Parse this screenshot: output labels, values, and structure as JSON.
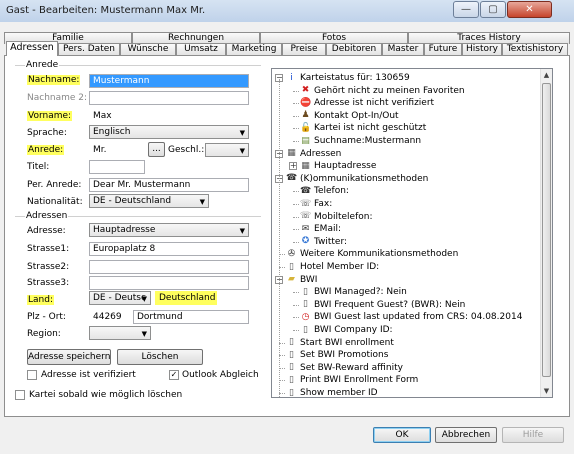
{
  "window": {
    "title": "Gast - Bearbeiten: Mustermann Max Mr."
  },
  "titlebar_buttons": {
    "minimize": "—",
    "maximize": "▢",
    "close": "✕"
  },
  "tabs_top": [
    "Familie",
    "Rechnungen",
    "Fotos",
    "Traces History"
  ],
  "tabs_bottom": [
    "Adressen",
    "Pers. Daten",
    "Wünsche",
    "Umsatz",
    "Marketing",
    "Preise",
    "Debitoren",
    "Master",
    "Future",
    "History",
    "Textishistory"
  ],
  "active_tab": "Adressen",
  "anrede_group": {
    "title": "Anrede",
    "nachname_label": "Nachname:",
    "nachname_value": "Mustermann",
    "nachname2_label": "Nachname 2:",
    "nachname2_value": "",
    "vorname_label": "Vorname:",
    "vorname_value": "Max",
    "sprache_label": "Sprache:",
    "sprache_value": "Englisch",
    "anrede_label": "Anrede:",
    "anrede_value": "Mr.",
    "anrede_button": "...",
    "geschl_label": "Geschl.:",
    "geschl_value": "",
    "titel_label": "Titel:",
    "titel_value": "",
    "per_anrede_label": "Per. Anrede:",
    "per_anrede_value": "Dear Mr. Mustermann",
    "nationalitaet_label": "Nationalität:",
    "nationalitaet_value": "DE - Deutschland"
  },
  "adressen_group": {
    "title": "Adressen",
    "adresse_label": "Adresse:",
    "adresse_value": "Hauptadresse",
    "strasse1_label": "Strasse1:",
    "strasse1_value": "Europaplatz 8",
    "strasse2_label": "Strasse2:",
    "strasse2_value": "",
    "strasse3_label": "Strasse3:",
    "strasse3_value": "",
    "land_label": "Land:",
    "land_value": "DE - Deutsc",
    "land_name": "Deutschland",
    "plz_ort_label": "Plz - Ort:",
    "plz_value": "44269",
    "ort_value": "Dortmund",
    "region_label": "Region:",
    "region_value": ""
  },
  "buttons": {
    "save_address": "Adresse speichern",
    "delete": "Löschen",
    "ok": "OK",
    "cancel": "Abbrechen",
    "help": "Hilfe"
  },
  "checkboxes": {
    "address_verified": {
      "label": "Adresse ist verifiziert",
      "checked": false
    },
    "outlook_sync": {
      "label": "Outlook Abgleich",
      "checked": true,
      "mark": "✓"
    },
    "delete_card": {
      "label": "Kartei sobald wie möglich löschen",
      "checked": false
    }
  },
  "tree": [
    {
      "text": "Karteistatus für: 130659",
      "icon": "info-icon",
      "glyph": "i",
      "color": "#1a4fd1",
      "level": 0,
      "expander": "-"
    },
    {
      "text": "Gehört nicht zu meinen Favoriten",
      "icon": "x-icon",
      "glyph": "✖",
      "color": "#d21f1f",
      "level": 1
    },
    {
      "text": "Adresse ist nicht verifiziert",
      "icon": "no-entry-icon",
      "glyph": "⛔",
      "color": "#d21f1f",
      "level": 1
    },
    {
      "text": "Kontakt Opt-In/Out",
      "icon": "person-icon",
      "glyph": "♟",
      "color": "#6b4a1f",
      "level": 1
    },
    {
      "text": "Kartei ist nicht geschützt",
      "icon": "lock-icon",
      "glyph": "🔓",
      "color": "#c8a22a",
      "level": 1
    },
    {
      "text": "Suchname:Mustermann",
      "icon": "card-icon",
      "glyph": "▤",
      "color": "#6a8c3a",
      "level": 1
    },
    {
      "text": "Adressen",
      "icon": "address-book-icon",
      "glyph": "▦",
      "color": "#555555",
      "level": 0,
      "expander": "-"
    },
    {
      "text": "Hauptadresse",
      "icon": "address-icon",
      "glyph": "▦",
      "color": "#555555",
      "level": 1,
      "expander": "+"
    },
    {
      "text": "(K)ommunikationsmethoden",
      "icon": "contacts-icon",
      "glyph": "☎",
      "color": "#333333",
      "level": 0,
      "expander": "-"
    },
    {
      "text": "Telefon:",
      "icon": "phone-icon",
      "glyph": "☎",
      "color": "#333333",
      "level": 1
    },
    {
      "text": "Fax:",
      "icon": "fax-icon",
      "glyph": "☏",
      "color": "#333333",
      "level": 1
    },
    {
      "text": "Mobiltelefon:",
      "icon": "mobile-icon",
      "glyph": "☏",
      "color": "#333333",
      "level": 1
    },
    {
      "text": "EMail:",
      "icon": "email-icon",
      "glyph": "✉",
      "color": "#333333",
      "level": 1
    },
    {
      "text": "Twitter:",
      "icon": "twitter-icon",
      "glyph": "✪",
      "color": "#3a7ad6",
      "level": 1
    },
    {
      "text": "Weitere Kommunikationsmethoden",
      "icon": "globe-icon",
      "glyph": "✇",
      "color": "#333333",
      "level": 0
    },
    {
      "text": "Hotel Member ID:",
      "icon": "document-icon",
      "glyph": "▯",
      "color": "#555555",
      "level": 0
    },
    {
      "text": "BWI",
      "icon": "folder-icon",
      "glyph": "▰",
      "color": "#d6b43a",
      "level": 0,
      "expander": "-"
    },
    {
      "text": "BWI Managed?: Nein",
      "icon": "document-icon",
      "glyph": "▯",
      "color": "#555555",
      "level": 1
    },
    {
      "text": "BWI Frequent Guest? (BWR): Nein",
      "icon": "document-icon",
      "glyph": "▯",
      "color": "#555555",
      "level": 1
    },
    {
      "text": "BWI Guest last updated from CRS: 04.08.2014",
      "icon": "clock-icon",
      "glyph": "◷",
      "color": "#d21f1f",
      "level": 1
    },
    {
      "text": "BWI Company ID:",
      "icon": "document-icon",
      "glyph": "▯",
      "color": "#555555",
      "level": 1
    },
    {
      "text": "Start BWI enrollment",
      "icon": "document-icon",
      "glyph": "▯",
      "color": "#555555",
      "level": 0
    },
    {
      "text": "Set BWI Promotions",
      "icon": "document-icon",
      "glyph": "▯",
      "color": "#555555",
      "level": 0
    },
    {
      "text": "Set BW-Reward affinity",
      "icon": "document-icon",
      "glyph": "▯",
      "color": "#555555",
      "level": 0
    },
    {
      "text": "Print BWI Enrollment Form",
      "icon": "document-icon",
      "glyph": "▯",
      "color": "#555555",
      "level": 0
    },
    {
      "text": "Show member ID",
      "icon": "document-icon",
      "glyph": "▯",
      "color": "#555555",
      "level": 0
    }
  ],
  "colors": {
    "highlight": "#ffff5e",
    "selection": "#3399ff",
    "accent": "#3c7fb1"
  }
}
